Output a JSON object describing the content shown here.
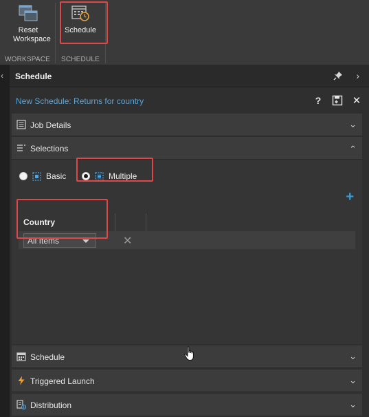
{
  "ribbon": {
    "workspace": {
      "button_label": "Reset Workspace",
      "group_label": "WORKSPACE",
      "icon": "reset-workspace-icon"
    },
    "schedule": {
      "button_label": "Schedule",
      "group_label": "SCHEDULE",
      "icon": "calendar-clock-icon"
    }
  },
  "panel": {
    "title": "Schedule",
    "schedule_name": "New Schedule: Returns for country",
    "tools": {
      "help": "?",
      "save_icon": "save-icon",
      "close": "✕"
    },
    "sections": {
      "job_details": "Job Details",
      "selections": "Selections",
      "schedule": "Schedule",
      "triggered_launch": "Triggered Launch",
      "distribution": "Distribution"
    },
    "selections": {
      "mode_basic": "Basic",
      "mode_multiple": "Multiple",
      "selected_mode": "Multiple",
      "add": "+",
      "column_header": "Country",
      "dropdown_value": "All Items"
    }
  },
  "colors": {
    "accent": "#3a9bd8",
    "highlight": "#e04848",
    "link": "#5aa4d6"
  }
}
